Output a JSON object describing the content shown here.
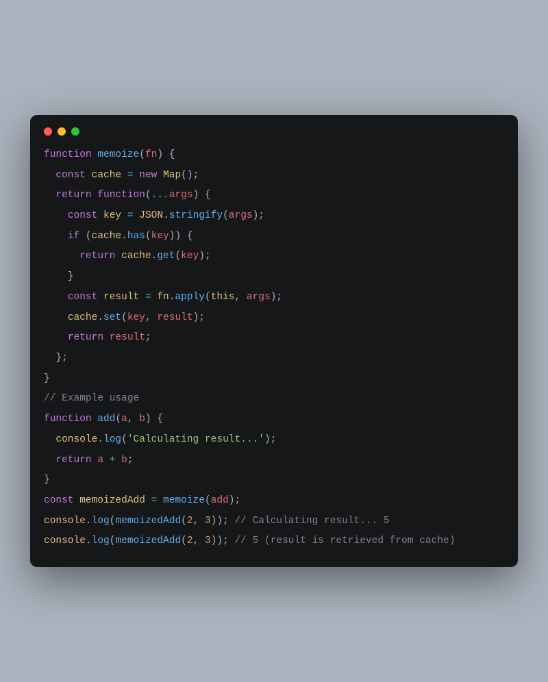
{
  "window": {
    "dots": [
      "#ff5f56",
      "#ffbd2e",
      "#27c93f"
    ]
  },
  "code": {
    "lines": [
      [
        [
          "kw",
          "function"
        ],
        [
          "p",
          " "
        ],
        [
          "fn",
          "memoize"
        ],
        [
          "p",
          "("
        ],
        [
          "prop",
          "fn"
        ],
        [
          "p",
          ") {"
        ]
      ],
      [],
      [
        [
          "p",
          "  "
        ],
        [
          "kw",
          "const"
        ],
        [
          "p",
          " "
        ],
        [
          "var",
          "cache"
        ],
        [
          "p",
          " "
        ],
        [
          "op",
          "="
        ],
        [
          "p",
          " "
        ],
        [
          "kw",
          "new"
        ],
        [
          "p",
          " "
        ],
        [
          "var",
          "Map"
        ],
        [
          "p",
          "();"
        ]
      ],
      [],
      [
        [
          "p",
          "  "
        ],
        [
          "kw",
          "return"
        ],
        [
          "p",
          " "
        ],
        [
          "kw",
          "function"
        ],
        [
          "p",
          "("
        ],
        [
          "op",
          "..."
        ],
        [
          "prop",
          "args"
        ],
        [
          "p",
          ") {"
        ]
      ],
      [],
      [
        [
          "p",
          "    "
        ],
        [
          "kw",
          "const"
        ],
        [
          "p",
          " "
        ],
        [
          "var",
          "key"
        ],
        [
          "p",
          " "
        ],
        [
          "op",
          "="
        ],
        [
          "p",
          " "
        ],
        [
          "var",
          "JSON"
        ],
        [
          "p",
          "."
        ],
        [
          "fn",
          "stringify"
        ],
        [
          "p",
          "("
        ],
        [
          "prop",
          "args"
        ],
        [
          "p",
          ");"
        ]
      ],
      [],
      [
        [
          "p",
          "    "
        ],
        [
          "kw",
          "if"
        ],
        [
          "p",
          " ("
        ],
        [
          "var",
          "cache"
        ],
        [
          "p",
          "."
        ],
        [
          "fn",
          "has"
        ],
        [
          "p",
          "("
        ],
        [
          "prop",
          "key"
        ],
        [
          "p",
          ")) {"
        ]
      ],
      [],
      [
        [
          "p",
          "      "
        ],
        [
          "kw",
          "return"
        ],
        [
          "p",
          " "
        ],
        [
          "var",
          "cache"
        ],
        [
          "p",
          "."
        ],
        [
          "fn",
          "get"
        ],
        [
          "p",
          "("
        ],
        [
          "prop",
          "key"
        ],
        [
          "p",
          ");"
        ]
      ],
      [],
      [
        [
          "p",
          "    }"
        ]
      ],
      [],
      [
        [
          "p",
          "    "
        ],
        [
          "kw",
          "const"
        ],
        [
          "p",
          " "
        ],
        [
          "var",
          "result"
        ],
        [
          "p",
          " "
        ],
        [
          "op",
          "="
        ],
        [
          "p",
          " "
        ],
        [
          "var",
          "fn"
        ],
        [
          "p",
          "."
        ],
        [
          "fn",
          "apply"
        ],
        [
          "p",
          "("
        ],
        [
          "this",
          "this"
        ],
        [
          "p",
          ", "
        ],
        [
          "prop",
          "args"
        ],
        [
          "p",
          ");"
        ]
      ],
      [],
      [
        [
          "p",
          "    "
        ],
        [
          "var",
          "cache"
        ],
        [
          "p",
          "."
        ],
        [
          "fn",
          "set"
        ],
        [
          "p",
          "("
        ],
        [
          "prop",
          "key"
        ],
        [
          "p",
          ", "
        ],
        [
          "prop",
          "result"
        ],
        [
          "p",
          ");"
        ]
      ],
      [],
      [
        [
          "p",
          "    "
        ],
        [
          "kw",
          "return"
        ],
        [
          "p",
          " "
        ],
        [
          "prop",
          "result"
        ],
        [
          "p",
          ";"
        ]
      ],
      [],
      [
        [
          "p",
          "  };"
        ]
      ],
      [],
      [
        [
          "p",
          "}"
        ]
      ],
      [],
      [
        [
          "cmt",
          "// Example usage"
        ]
      ],
      [],
      [
        [
          "kw",
          "function"
        ],
        [
          "p",
          " "
        ],
        [
          "fn",
          "add"
        ],
        [
          "p",
          "("
        ],
        [
          "prop",
          "a"
        ],
        [
          "p",
          ", "
        ],
        [
          "prop",
          "b"
        ],
        [
          "p",
          ") {"
        ]
      ],
      [],
      [
        [
          "p",
          "  "
        ],
        [
          "var",
          "console"
        ],
        [
          "p",
          "."
        ],
        [
          "fn",
          "log"
        ],
        [
          "p",
          "("
        ],
        [
          "str",
          "'Calculating result...'"
        ],
        [
          "p",
          ");"
        ]
      ],
      [],
      [
        [
          "p",
          "  "
        ],
        [
          "kw",
          "return"
        ],
        [
          "p",
          " "
        ],
        [
          "prop",
          "a"
        ],
        [
          "p",
          " "
        ],
        [
          "op",
          "+"
        ],
        [
          "p",
          " "
        ],
        [
          "prop",
          "b"
        ],
        [
          "p",
          ";"
        ]
      ],
      [],
      [
        [
          "p",
          "}"
        ]
      ],
      [],
      [
        [
          "kw",
          "const"
        ],
        [
          "p",
          " "
        ],
        [
          "var",
          "memoizedAdd"
        ],
        [
          "p",
          " "
        ],
        [
          "op",
          "="
        ],
        [
          "p",
          " "
        ],
        [
          "fn",
          "memoize"
        ],
        [
          "p",
          "("
        ],
        [
          "prop",
          "add"
        ],
        [
          "p",
          ");"
        ]
      ],
      [],
      [
        [
          "var",
          "console"
        ],
        [
          "p",
          "."
        ],
        [
          "fn",
          "log"
        ],
        [
          "p",
          "("
        ],
        [
          "fn",
          "memoizedAdd"
        ],
        [
          "p",
          "("
        ],
        [
          "num",
          "2"
        ],
        [
          "p",
          ", "
        ],
        [
          "num",
          "3"
        ],
        [
          "p",
          ")); "
        ],
        [
          "cmt",
          "// Calculating result... 5"
        ]
      ],
      [],
      [
        [
          "var",
          "console"
        ],
        [
          "p",
          "."
        ],
        [
          "fn",
          "log"
        ],
        [
          "p",
          "("
        ],
        [
          "fn",
          "memoizedAdd"
        ],
        [
          "p",
          "("
        ],
        [
          "num",
          "2"
        ],
        [
          "p",
          ", "
        ],
        [
          "num",
          "3"
        ],
        [
          "p",
          ")); "
        ],
        [
          "cmt",
          "// 5 (result is retrieved from cache)"
        ]
      ]
    ]
  }
}
